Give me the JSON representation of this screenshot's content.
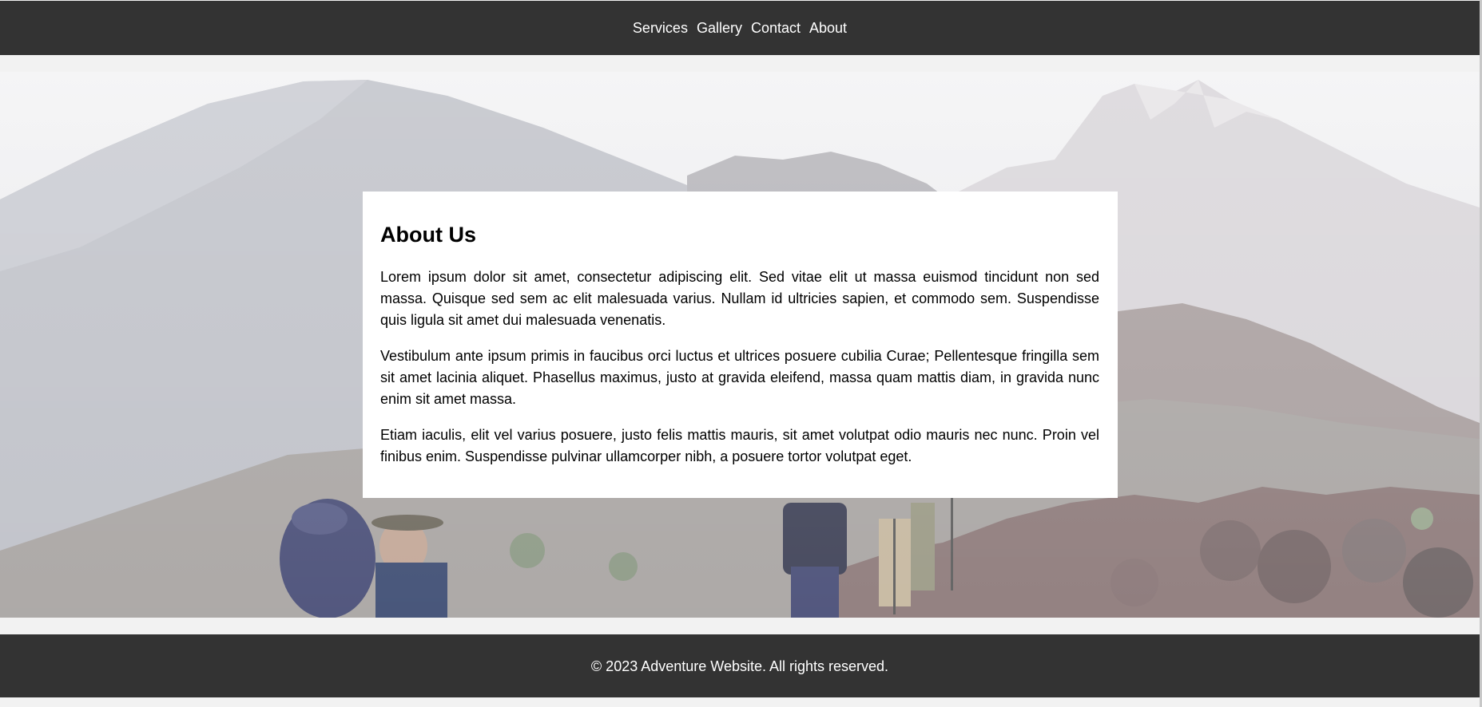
{
  "nav": {
    "items": [
      {
        "label": "Services"
      },
      {
        "label": "Gallery"
      },
      {
        "label": "Contact"
      },
      {
        "label": "About"
      }
    ]
  },
  "hero": {
    "image_description_icon": "mountain-hikers-photo"
  },
  "about": {
    "heading": "About Us",
    "paragraphs": [
      "Lorem ipsum dolor sit amet, consectetur adipiscing elit. Sed vitae elit ut massa euismod tincidunt non sed massa. Quisque sed sem ac elit malesuada varius. Nullam id ultricies sapien, et commodo sem. Suspendisse quis ligula sit amet dui malesuada venenatis.",
      "Vestibulum ante ipsum primis in faucibus orci luctus et ultrices posuere cubilia Curae; Pellentesque fringilla sem sit amet lacinia aliquet. Phasellus maximus, justo at gravida eleifend, massa quam mattis diam, in gravida nunc enim sit amet massa.",
      "Etiam iaculis, elit vel varius posuere, justo felis mattis mauris, sit amet volutpat odio mauris nec nunc. Proin vel finibus enim. Suspendisse pulvinar ullamcorper nibh, a posuere tortor volutpat eget."
    ]
  },
  "footer": {
    "copyright": "© 2023 Adventure Website. All rights reserved."
  },
  "colors": {
    "bar_background": "#333333",
    "page_background": "#f2f2f2",
    "card_background": "#ffffff",
    "text_light": "#ffffff",
    "text_dark": "#000000"
  }
}
